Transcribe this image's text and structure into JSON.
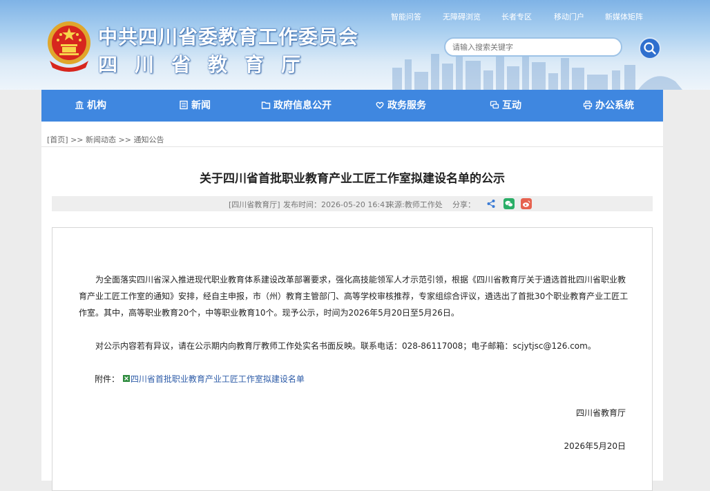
{
  "header": {
    "title_party": "中共四川省委教育工作委员会",
    "title_dept": "四川省教育厅",
    "top_links": [
      "智能问答",
      "无障碍浏览",
      "长者专区",
      "移动门户",
      "新媒体矩阵"
    ],
    "search_placeholder": "请输入搜索关键字"
  },
  "nav": {
    "items": [
      {
        "label": "机构",
        "icon": "building-icon"
      },
      {
        "label": "新闻",
        "icon": "newspaper-icon"
      },
      {
        "label": "政府信息公开",
        "icon": "folder-icon"
      },
      {
        "label": "政务服务",
        "icon": "heart-hand-icon"
      },
      {
        "label": "互动",
        "icon": "chat-icon"
      },
      {
        "label": "办公系统",
        "icon": "printer-icon"
      }
    ]
  },
  "breadcrumb": {
    "home": "[首页]",
    "sep": ">>",
    "level1": "新闻动态",
    "level2": "通知公告"
  },
  "article": {
    "title": "关于四川省首批职业教育产业工匠工作室拟建设名单的公示",
    "source_tag": "[四川省教育厅]",
    "publish_time": "发布时间：2026-05-20 16:41",
    "origin": "来源:教师工作处",
    "share_label": "分享：",
    "paragraph1": "为全面落实四川省深入推进现代职业教育体系建设改革部署要求，强化高技能领军人才示范引领，根据《四川省教育厅关于遴选首批四川省职业教育产业工匠工作室的通知》安排，经自主申报，市（州）教育主管部门、高等学校审核推荐，专家组综合评议，遴选出了首批30个职业教育产业工匠工作室。其中，高等职业教育20个，中等职业教育10个。现予公示，时间为2026年5月20日至5月26日。",
    "paragraph2": "对公示内容若有异议，请在公示期内向教育厅教师工作处实名书面反映。联系电话：028-86117008；电子邮箱：scjytjsc@126.com。",
    "attachment_label": "附件：",
    "attachment_link": "四川省首批职业教育产业工匠工作室拟建设名单",
    "signature": "四川省教育厅",
    "date": "2026年5月20日"
  },
  "colors": {
    "nav_bg": "#3f87e0",
    "link": "#2e5ca8",
    "wechat": "#2aae67",
    "weibo": "#e6624f"
  }
}
